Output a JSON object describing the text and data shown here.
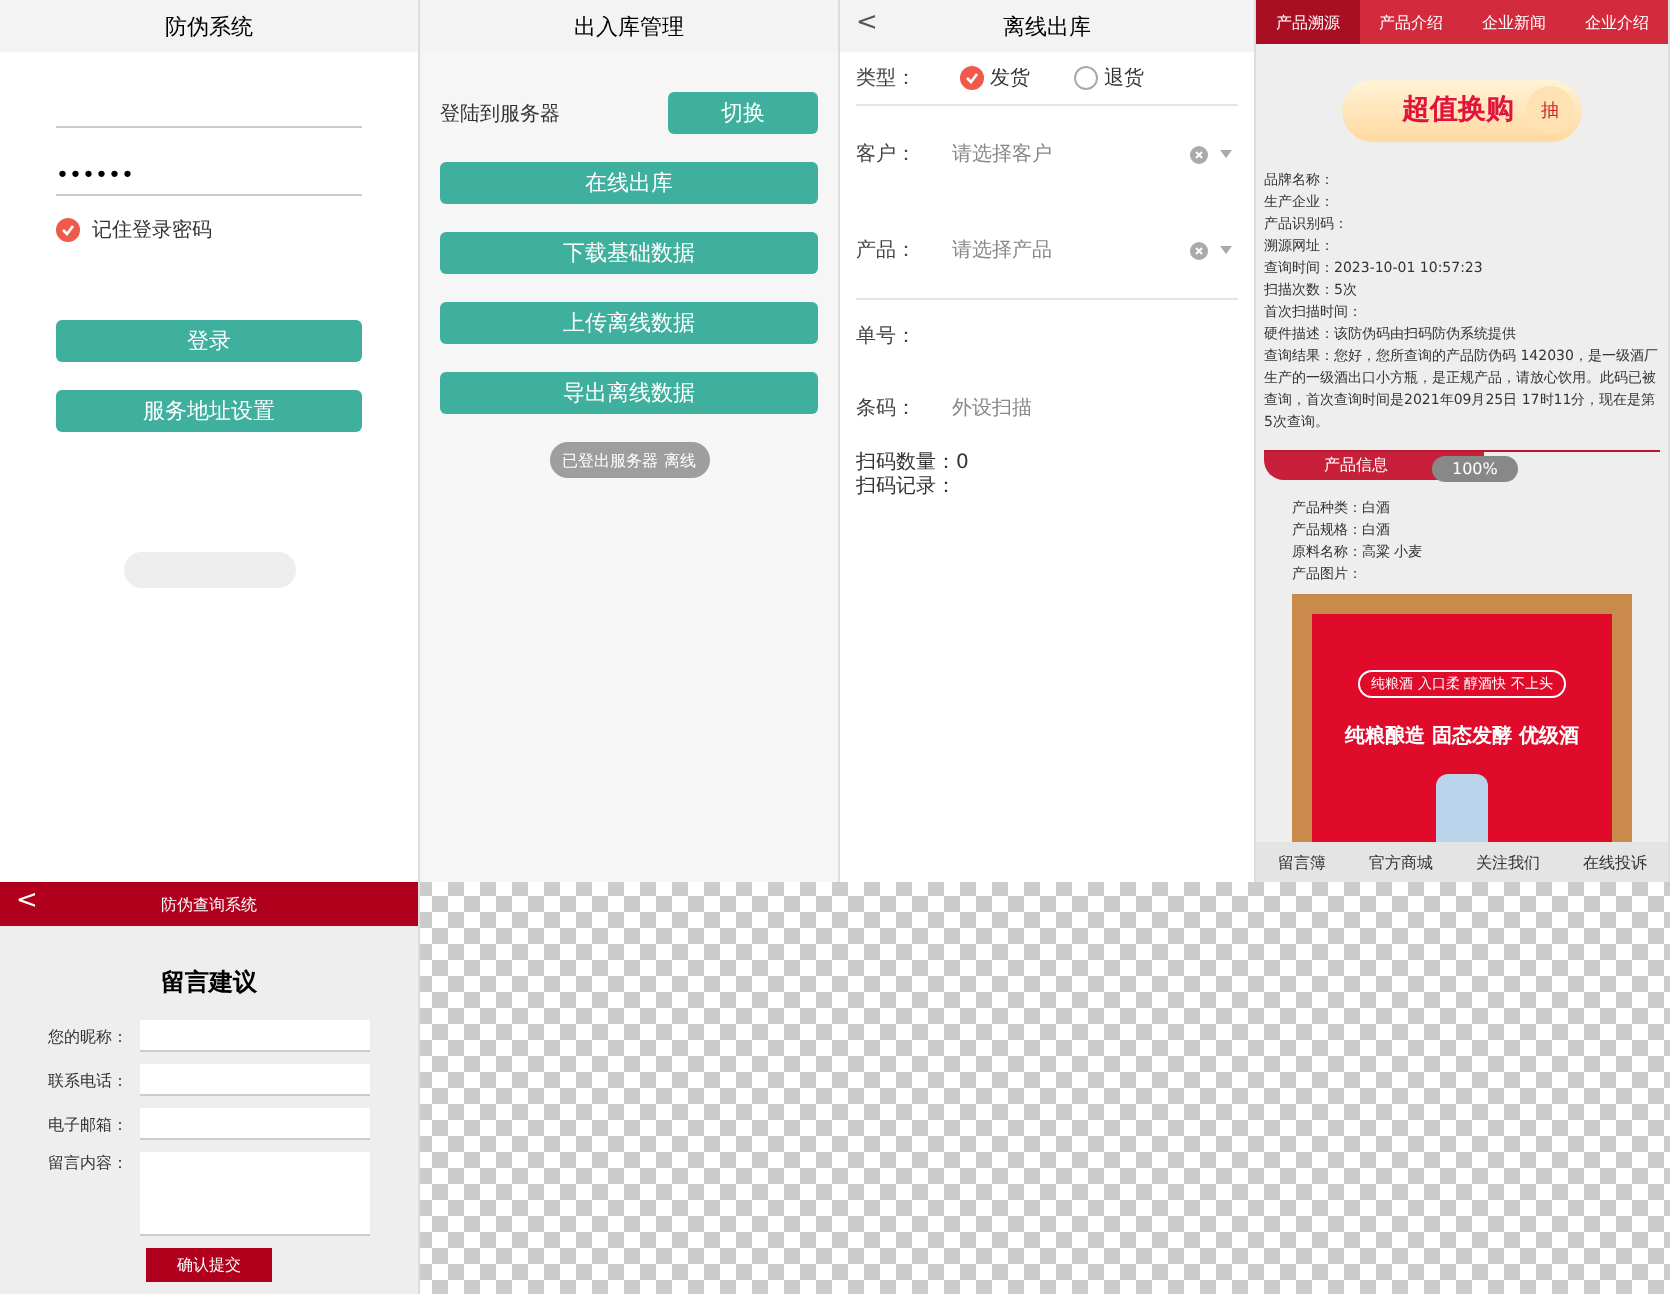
{
  "login_screen": {
    "title": "防伪系统",
    "password": "••••••",
    "remember": {
      "label": "记住登录密码",
      "checked": true
    },
    "buttons": [
      "登录",
      "服务地址设置"
    ]
  },
  "stock_screen": {
    "title": "出入库管理",
    "server_label": "登陆到服务器",
    "switch_button": "切换",
    "buttons": [
      "在线出库",
      "下载基础数据",
      "上传离线数据",
      "导出离线数据"
    ],
    "toast": "已登出服务器 离线"
  },
  "offline_screen": {
    "back": "<",
    "title": "离线出库",
    "type_label": "类型：",
    "types": [
      {
        "label": "发货",
        "selected": true
      },
      {
        "label": "退货",
        "selected": false
      }
    ],
    "selects": [
      {
        "label": "客户：",
        "placeholder": "请选择客户"
      },
      {
        "label": "产品：",
        "placeholder": "请选择产品"
      }
    ],
    "fields": [
      {
        "label": "单号："
      },
      {
        "label": "条码：",
        "value": "外设扫描"
      }
    ],
    "count": "扫码数量：0",
    "record": "扫码记录："
  },
  "trace_screen": {
    "tabs": [
      {
        "label": "产品溯源",
        "selected": true
      },
      {
        "label": "产品介绍",
        "selected": false
      },
      {
        "label": "企业新闻",
        "selected": false
      },
      {
        "label": "企业介绍",
        "selected": false
      }
    ],
    "banner": {
      "title": "超值换购",
      "button": "抽"
    },
    "info_lines": [
      "品牌名称：",
      "生产企业：",
      "产品识别码：",
      "溯源网址：",
      "查询时间：2023-10-01 10:57:23",
      "扫描次数：5次",
      "首次扫描时间：",
      "硬件描述：该防伪码由扫码防伪系统提供"
    ],
    "result": "查询结果：您好，您所查询的产品防伪码 142030，是一级酒厂生产的一级酒出口小方瓶，是正规产品，请放心饮用。此码已被查询，首次查询时间是2021年09月25日 17时11分，现在是第5次查询。",
    "section": {
      "label": "产品信息",
      "badge": "100%"
    },
    "product_lines": [
      "产品种类：白酒",
      "产品规格：白酒",
      "原料名称：高粱 小麦",
      "产品图片："
    ],
    "poster": {
      "tags": "纯粮酒  入口柔  醇酒快  不上头",
      "slogan": "纯粮酿造 固态发酵 优级酒"
    },
    "nav": [
      "留言簿",
      "官方商城",
      "关注我们",
      "在线投诉"
    ]
  },
  "feedback_screen": {
    "back": "<",
    "title": "防伪查询系统",
    "heading": "留言建议",
    "fields": [
      {
        "label": "您的昵称：",
        "kind": "line"
      },
      {
        "label": "联系电话：",
        "kind": "line"
      },
      {
        "label": "电子邮箱：",
        "kind": "line"
      },
      {
        "label": "留言内容：",
        "kind": "area"
      }
    ],
    "submit": "确认提交"
  }
}
